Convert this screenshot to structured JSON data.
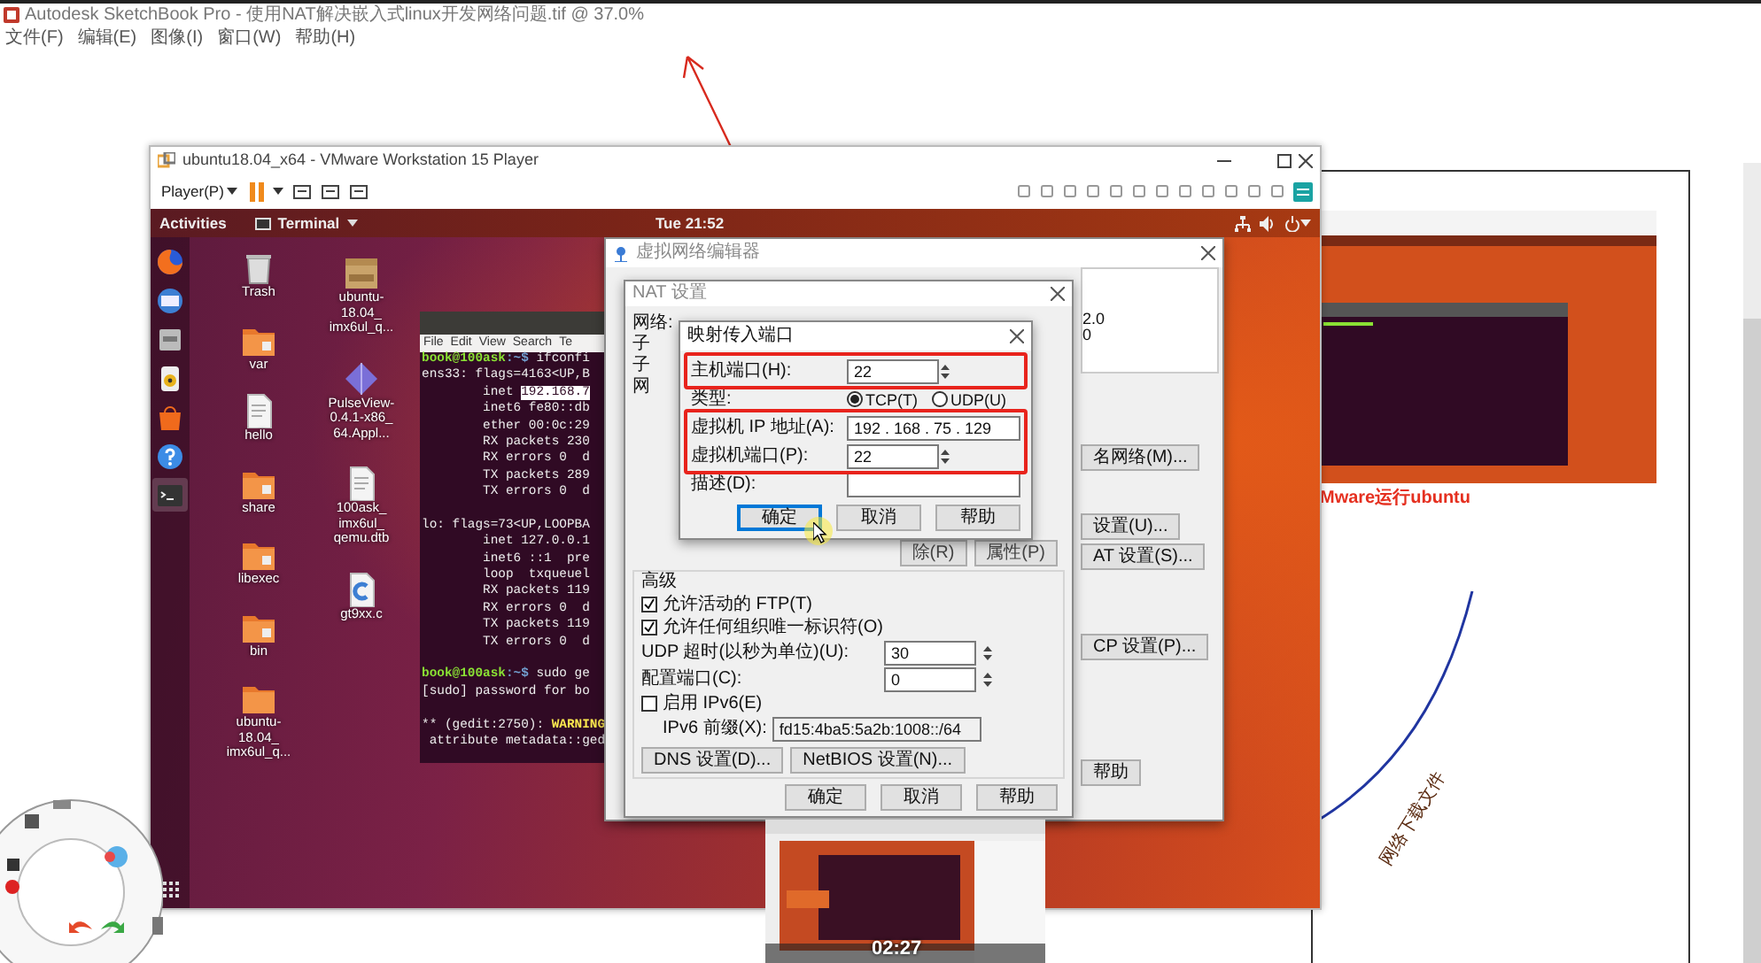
{
  "app": {
    "title": "Autodesk SketchBook Pro - 使用NAT解决嵌入式linux开发网络问题.tif @ 37.0%",
    "menu": [
      "文件(F)",
      "编辑(E)",
      "图像(I)",
      "窗口(W)",
      "帮助(H)"
    ]
  },
  "vmware": {
    "title": "ubuntu18.04_x64 - VMware Workstation 15 Player",
    "player_menu": "Player(P)"
  },
  "ubuntu": {
    "activities": "Activities",
    "app_menu": "Terminal",
    "clock": "Tue 21:52"
  },
  "dock": [
    {
      "kind": "browser",
      "selected": false
    },
    {
      "kind": "mail",
      "selected": false
    },
    {
      "kind": "files",
      "selected": false
    },
    {
      "kind": "music",
      "selected": false
    },
    {
      "kind": "store",
      "selected": false
    },
    {
      "kind": "help",
      "selected": false
    },
    {
      "kind": "terminal",
      "selected": true
    }
  ],
  "desktop_icons": [
    {
      "kind": "trash",
      "label": "Trash"
    },
    {
      "kind": "folder",
      "label": "var"
    },
    {
      "kind": "file",
      "label": "hello"
    },
    {
      "kind": "folder",
      "label": "share"
    },
    {
      "kind": "folder",
      "label": "libexec"
    },
    {
      "kind": "folder",
      "label": "bin"
    },
    {
      "kind": "folder-plain",
      "label": "ubuntu-\n18.04_\nimx6ul_q..."
    },
    {
      "kind": "archive",
      "label": "ubuntu-\n18.04_\nimx6ul_q..."
    },
    {
      "kind": "diamond",
      "label": "PulseView-\n0.4.1-x86_\n64.Appl..."
    },
    {
      "kind": "file",
      "label": "100ask_\nimx6ul_\nqemu.dtb"
    },
    {
      "kind": "c-file",
      "label": "gt9xx.c"
    }
  ],
  "terminal": {
    "menu": [
      "File",
      "Edit",
      "View",
      "Search",
      "Te"
    ],
    "lines": [
      {
        "kind": "prompt",
        "user": "book@100ask",
        "path": ":~$ ",
        "text": "ifconfi"
      },
      {
        "kind": "plain",
        "text": "ens33: flags=4163<UP,B"
      },
      {
        "kind": "selection",
        "text": "        inet ",
        "selected_text": "192.168.7"
      },
      {
        "kind": "plain",
        "text": "        inet6 fe80::db"
      },
      {
        "kind": "plain",
        "text": "        ether 00:0c:29"
      },
      {
        "kind": "plain",
        "text": "        RX packets 230"
      },
      {
        "kind": "plain",
        "text": "        RX errors 0  d"
      },
      {
        "kind": "plain",
        "text": "        TX packets 289"
      },
      {
        "kind": "plain",
        "text": "        TX errors 0  d"
      },
      {
        "kind": "blank"
      },
      {
        "kind": "plain",
        "text": "lo: flags=73<UP,LOOPBA"
      },
      {
        "kind": "plain",
        "text": "        inet 127.0.0.1"
      },
      {
        "kind": "plain",
        "text": "        inet6 ::1  pre"
      },
      {
        "kind": "plain",
        "text": "        loop  txqueuel"
      },
      {
        "kind": "plain",
        "text": "        RX packets 119"
      },
      {
        "kind": "plain",
        "text": "        RX errors 0  d"
      },
      {
        "kind": "plain",
        "text": "        TX packets 119"
      },
      {
        "kind": "plain",
        "text": "        TX errors 0  d"
      },
      {
        "kind": "blank"
      },
      {
        "kind": "prompt",
        "user": "book@100ask",
        "path": ":~$ ",
        "text": "sudo ge"
      },
      {
        "kind": "plain",
        "text": "[sudo] password for bo"
      },
      {
        "kind": "blank"
      },
      {
        "kind": "warning",
        "text": "** (gedit:2750): ",
        "warning": "WARNING"
      },
      {
        "kind": "plain",
        "text": " attribute metadata::ged"
      }
    ]
  },
  "network_editor": {
    "title": "虚拟网络编辑器",
    "table_cells": [
      "2.0",
      "0"
    ],
    "buttons": [
      "名网络(M)...",
      "设置(U)...",
      "AT 设置(S)...",
      "CP 设置(P)...",
      "帮助"
    ]
  },
  "nat_settings": {
    "title": "NAT 设置",
    "labels": [
      "网络:",
      "子",
      "子",
      "网"
    ],
    "forward_buttons": [
      "除(R)",
      "属性(P)"
    ],
    "advanced_title": "高级",
    "options": [
      {
        "kind": "checkbox",
        "label": "允许活动的 FTP(T)",
        "checked": true
      },
      {
        "kind": "checkbox",
        "label": "允许任何组织唯一标识符(O)",
        "checked": true
      },
      {
        "kind": "spin",
        "label": "UDP 超时(以秒为单位)(U):",
        "value": "30"
      },
      {
        "kind": "spin",
        "label": "配置端口(C):",
        "value": "0"
      },
      {
        "kind": "checkbox",
        "label": "启用 IPv6(E)",
        "checked": false
      },
      {
        "kind": "text",
        "label": "IPv6 前缀(X):",
        "value": "fd15:4ba5:5a2b:1008::/64"
      }
    ],
    "extra_buttons": [
      "DNS 设置(D)...",
      "NetBIOS 设置(N)..."
    ],
    "buttons": [
      "确定",
      "取消",
      "帮助"
    ]
  },
  "port_dialog": {
    "title": "映射传入端口",
    "host_port": {
      "label": "主机端口(H):",
      "value": "22",
      "highlighted": true
    },
    "type": {
      "label": "类型:",
      "highlighted": false,
      "options": [
        {
          "label": "TCP(T)",
          "selected": true
        },
        {
          "label": "UDP(U)",
          "selected": false
        }
      ]
    },
    "vm_ip": {
      "label": "虚拟机 IP 地址(A):",
      "value": "192 . 168 . 75 . 129",
      "highlighted": true
    },
    "vm_port": {
      "label": "虚拟机端口(P):",
      "value": "22",
      "highlighted": true
    },
    "description": {
      "label": "描述(D):",
      "highlighted": false
    },
    "buttons": [
      {
        "label": "确定",
        "focused": true
      },
      {
        "label": "取消",
        "focused": false
      },
      {
        "label": "帮助",
        "focused": false
      }
    ]
  },
  "document": {
    "caption": "Mware运行ubuntu",
    "curve_label": "网络下载文件"
  },
  "video_preview": {
    "time": "02:27"
  }
}
